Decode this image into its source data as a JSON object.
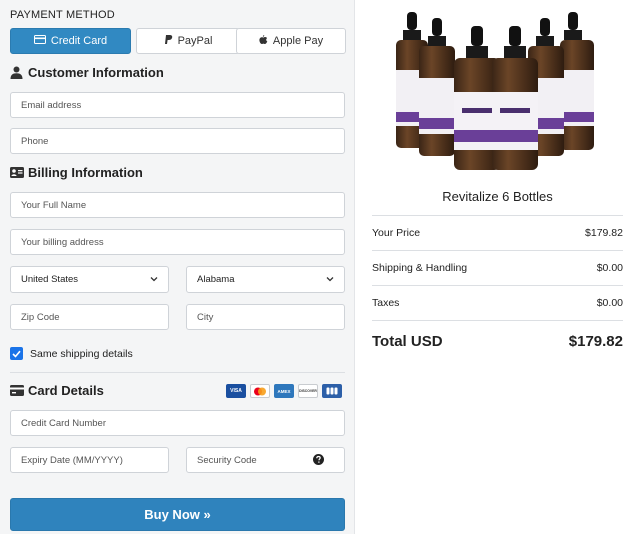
{
  "payment": {
    "title": "PAYMENT METHOD",
    "tabs": [
      {
        "label": "Credit Card",
        "icon": "credit-card-icon",
        "active": true
      },
      {
        "label": "PayPal",
        "icon": "paypal-icon",
        "active": false
      },
      {
        "label": "Apple Pay",
        "icon": "apple-icon",
        "active": false
      }
    ]
  },
  "customer": {
    "title": "Customer Information",
    "email_placeholder": "Email address",
    "phone_placeholder": "Phone"
  },
  "billing": {
    "title": "Billing Information",
    "name_placeholder": "Your Full Name",
    "address_placeholder": "Your billing address",
    "country": "United States",
    "state": "Alabama",
    "zip_placeholder": "Zip Code",
    "city_placeholder": "City",
    "same_shipping_label": "Same shipping details",
    "same_shipping_checked": true
  },
  "card": {
    "title": "Card Details",
    "number_placeholder": "Credit Card Number",
    "expiry_placeholder": "Expiry Date (MM/YYYY)",
    "security_placeholder": "Security Code",
    "logos": [
      {
        "name": "visa",
        "text": "VISA",
        "color": "#1a4fa0"
      },
      {
        "name": "mastercard",
        "text": "",
        "color": "#ffffff"
      },
      {
        "name": "amex",
        "text": "AMEX",
        "color": "#2e77bc"
      },
      {
        "name": "discover",
        "text": "DISCOVER",
        "color": "#ffffff"
      },
      {
        "name": "jcb",
        "text": "",
        "color": "#2c5fa8"
      }
    ]
  },
  "buy_button": "Buy Now »",
  "summary": {
    "product_name": "Revitalize 6 Bottles",
    "rows": [
      {
        "label": "Your Price",
        "value": "$179.82"
      },
      {
        "label": "Shipping & Handling",
        "value": "$0.00"
      },
      {
        "label": "Taxes",
        "value": "$0.00"
      }
    ],
    "total_label": "Total USD",
    "total_value": "$179.82"
  },
  "colors": {
    "accent": "#3189c2",
    "bottle_label": "#6a3f98"
  }
}
